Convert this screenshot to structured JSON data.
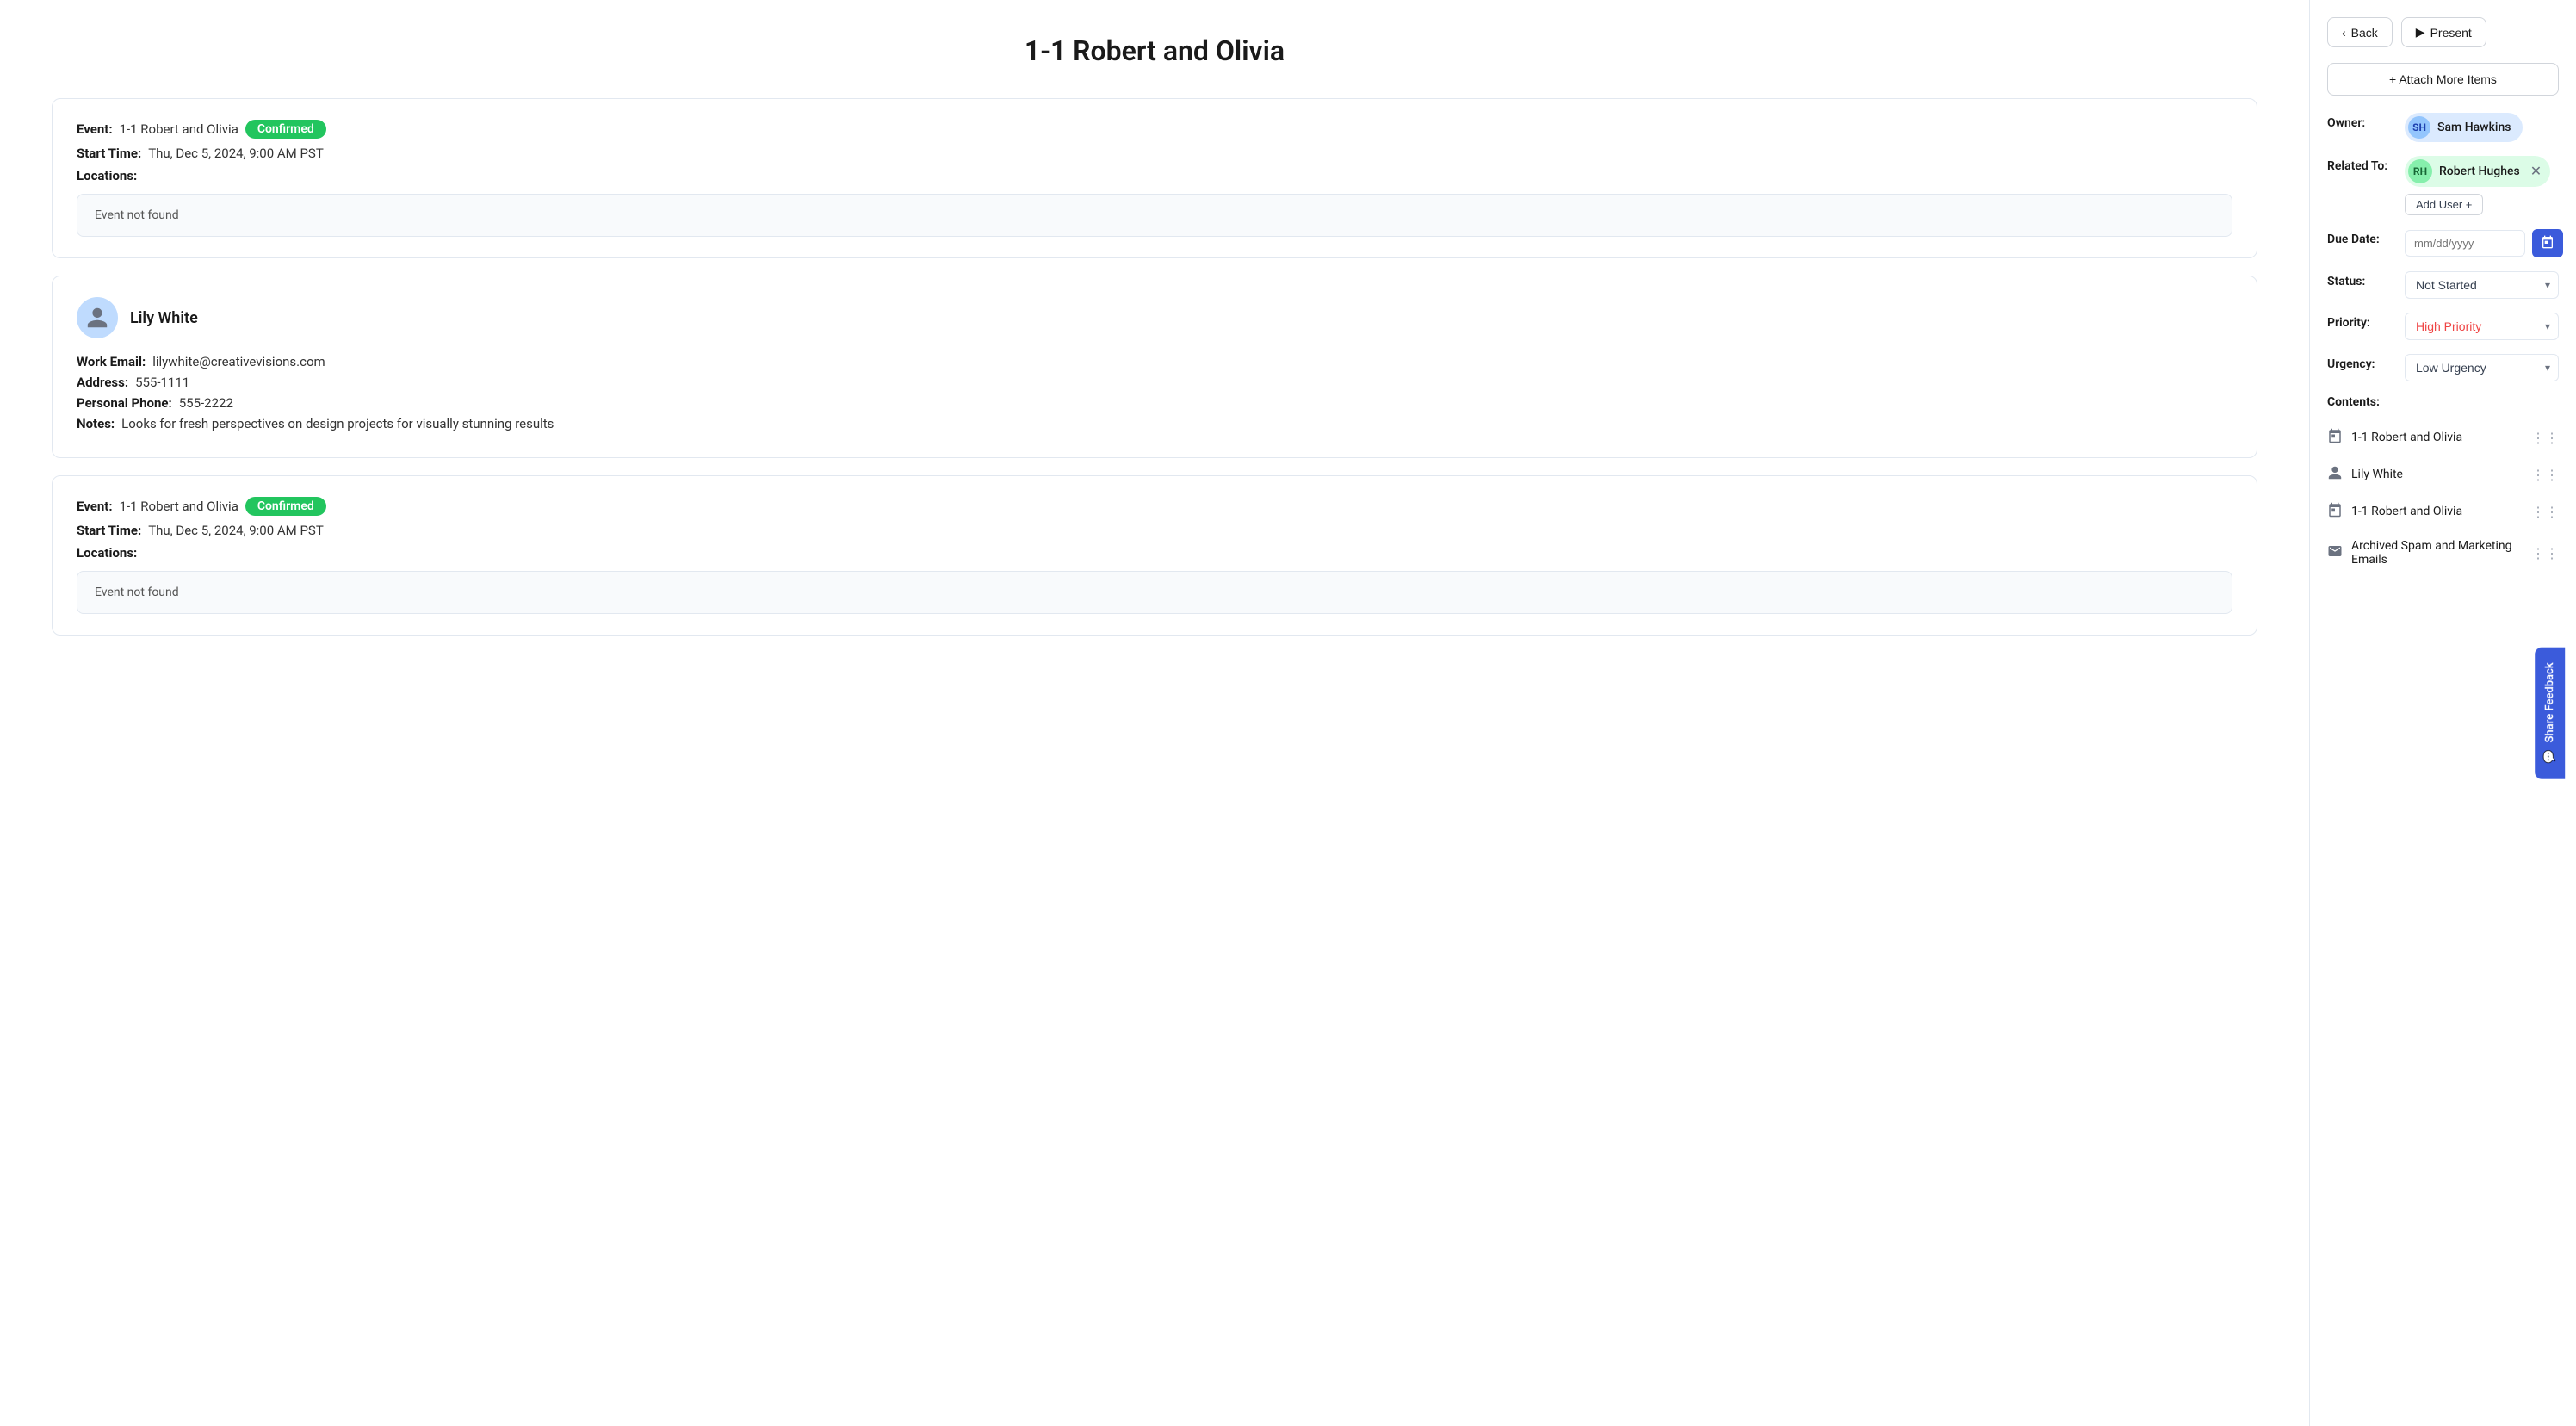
{
  "page": {
    "title": "1-1 Robert and Olivia"
  },
  "toolbar": {
    "back_label": "Back",
    "present_label": "Present",
    "attach_label": "+ Attach More Items"
  },
  "sidebar": {
    "owner_label": "Owner:",
    "owner_name": "Sam Hawkins",
    "related_label": "Related To:",
    "related_name": "Robert\nHughes",
    "related_name_display": "Robert Hughes",
    "add_user_label": "Add User +",
    "due_date_label": "Due Date:",
    "due_date_placeholder": "mm/dd/yyyy",
    "status_label": "Status:",
    "status_value": "Not Started",
    "priority_label": "Priority:",
    "priority_value": "High Priority",
    "urgency_label": "Urgency:",
    "urgency_value": "Low Urgency",
    "contents_label": "Contents:",
    "contents": [
      {
        "icon": "calendar",
        "name": "1-1 Robert and Olivia"
      },
      {
        "icon": "contact",
        "name": "Lily White"
      },
      {
        "icon": "calendar",
        "name": "1-1 Robert and Olivia"
      },
      {
        "icon": "email",
        "name": "Archived Spam and Marketing Emails"
      }
    ]
  },
  "event_card_1": {
    "event_label": "Event:",
    "event_name": "1-1 Robert and Olivia",
    "status_badge": "Confirmed",
    "start_time_label": "Start Time:",
    "start_time": "Thu, Dec 5, 2024, 9:00 AM PST",
    "locations_label": "Locations:",
    "not_found": "Event not found"
  },
  "contact_card": {
    "name": "Lily White",
    "work_email_label": "Work Email:",
    "work_email": "lilywhite@creativevisions.com",
    "address_label": "Address:",
    "address": "555-1111",
    "personal_phone_label": "Personal Phone:",
    "personal_phone": "555-2222",
    "notes_label": "Notes:",
    "notes": "Looks for fresh perspectives on design projects for visually stunning results"
  },
  "event_card_2": {
    "event_label": "Event:",
    "event_name": "1-1 Robert and Olivia",
    "status_badge": "Confirmed",
    "start_time_label": "Start Time:",
    "start_time": "Thu, Dec 5, 2024, 9:00 AM PST",
    "locations_label": "Locations:",
    "not_found": "Event not found"
  },
  "feedback": {
    "label": "Share Feedback"
  },
  "colors": {
    "confirmed_bg": "#22c55e",
    "priority_color": "#ef4444",
    "accent": "#3b5bdb"
  }
}
